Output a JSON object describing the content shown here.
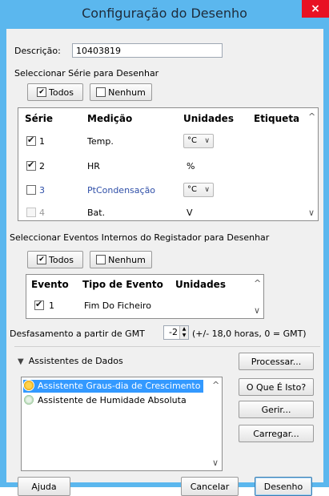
{
  "window": {
    "title": "Configuração do Desenho",
    "close_glyph": "×"
  },
  "description": {
    "label": "Descrição:",
    "value": "10403819"
  },
  "series_section": {
    "heading": "Seleccionar Série para Desenhar",
    "all_label": "Todos",
    "none_label": "Nenhum",
    "columns": [
      "Série",
      "Medição",
      "Unidades",
      "Etiqueta"
    ],
    "rows": [
      {
        "num": "1",
        "measure": "Temp.",
        "unit": "°C",
        "checked": true,
        "combo": true,
        "state": "normal"
      },
      {
        "num": "2",
        "measure": "HR",
        "unit": "%",
        "checked": true,
        "combo": false,
        "state": "normal"
      },
      {
        "num": "3",
        "measure": "PtCondensação",
        "unit": "°C",
        "checked": false,
        "combo": true,
        "state": "link"
      },
      {
        "num": "4",
        "measure": "Bat.",
        "unit": "V",
        "checked": false,
        "combo": false,
        "state": "disabled"
      }
    ]
  },
  "events_section": {
    "heading": "Seleccionar Eventos Internos do Registador para Desenhar",
    "all_label": "Todos",
    "none_label": "Nenhum",
    "columns": [
      "Evento",
      "Tipo de Evento",
      "Unidades"
    ],
    "rows": [
      {
        "num": "1",
        "type": "Fim Do Ficheiro",
        "unit": "",
        "checked": true
      }
    ]
  },
  "gmt": {
    "label": "Desfasamento a partir de GMT",
    "value": "-2",
    "hint": "(+/- 18,0 horas, 0 = GMT)"
  },
  "assistants": {
    "heading": "Assistentes de Dados",
    "items": [
      {
        "label": "Assistente Graus-dia de Crescimento",
        "selected": true
      },
      {
        "label": "Assistente de Humidade Absoluta",
        "selected": false
      }
    ],
    "buttons": {
      "process": "Processar...",
      "what": "O Que É Isto?",
      "manage": "Gerir...",
      "load": "Carregar..."
    }
  },
  "footer": {
    "help": "Ajuda",
    "cancel": "Cancelar",
    "draw": "Desenho"
  },
  "colors": {
    "titlebar": "#5bb7ee",
    "close": "#e81123",
    "selection": "#3399ff",
    "link": "#2f4fa8",
    "dialog_bg": "#f0f0f0"
  },
  "icons": {
    "checkbox_checked": "checkbox-checked-icon",
    "checkbox_empty": "checkbox-empty-icon",
    "triangle": "triangle-down-icon"
  }
}
